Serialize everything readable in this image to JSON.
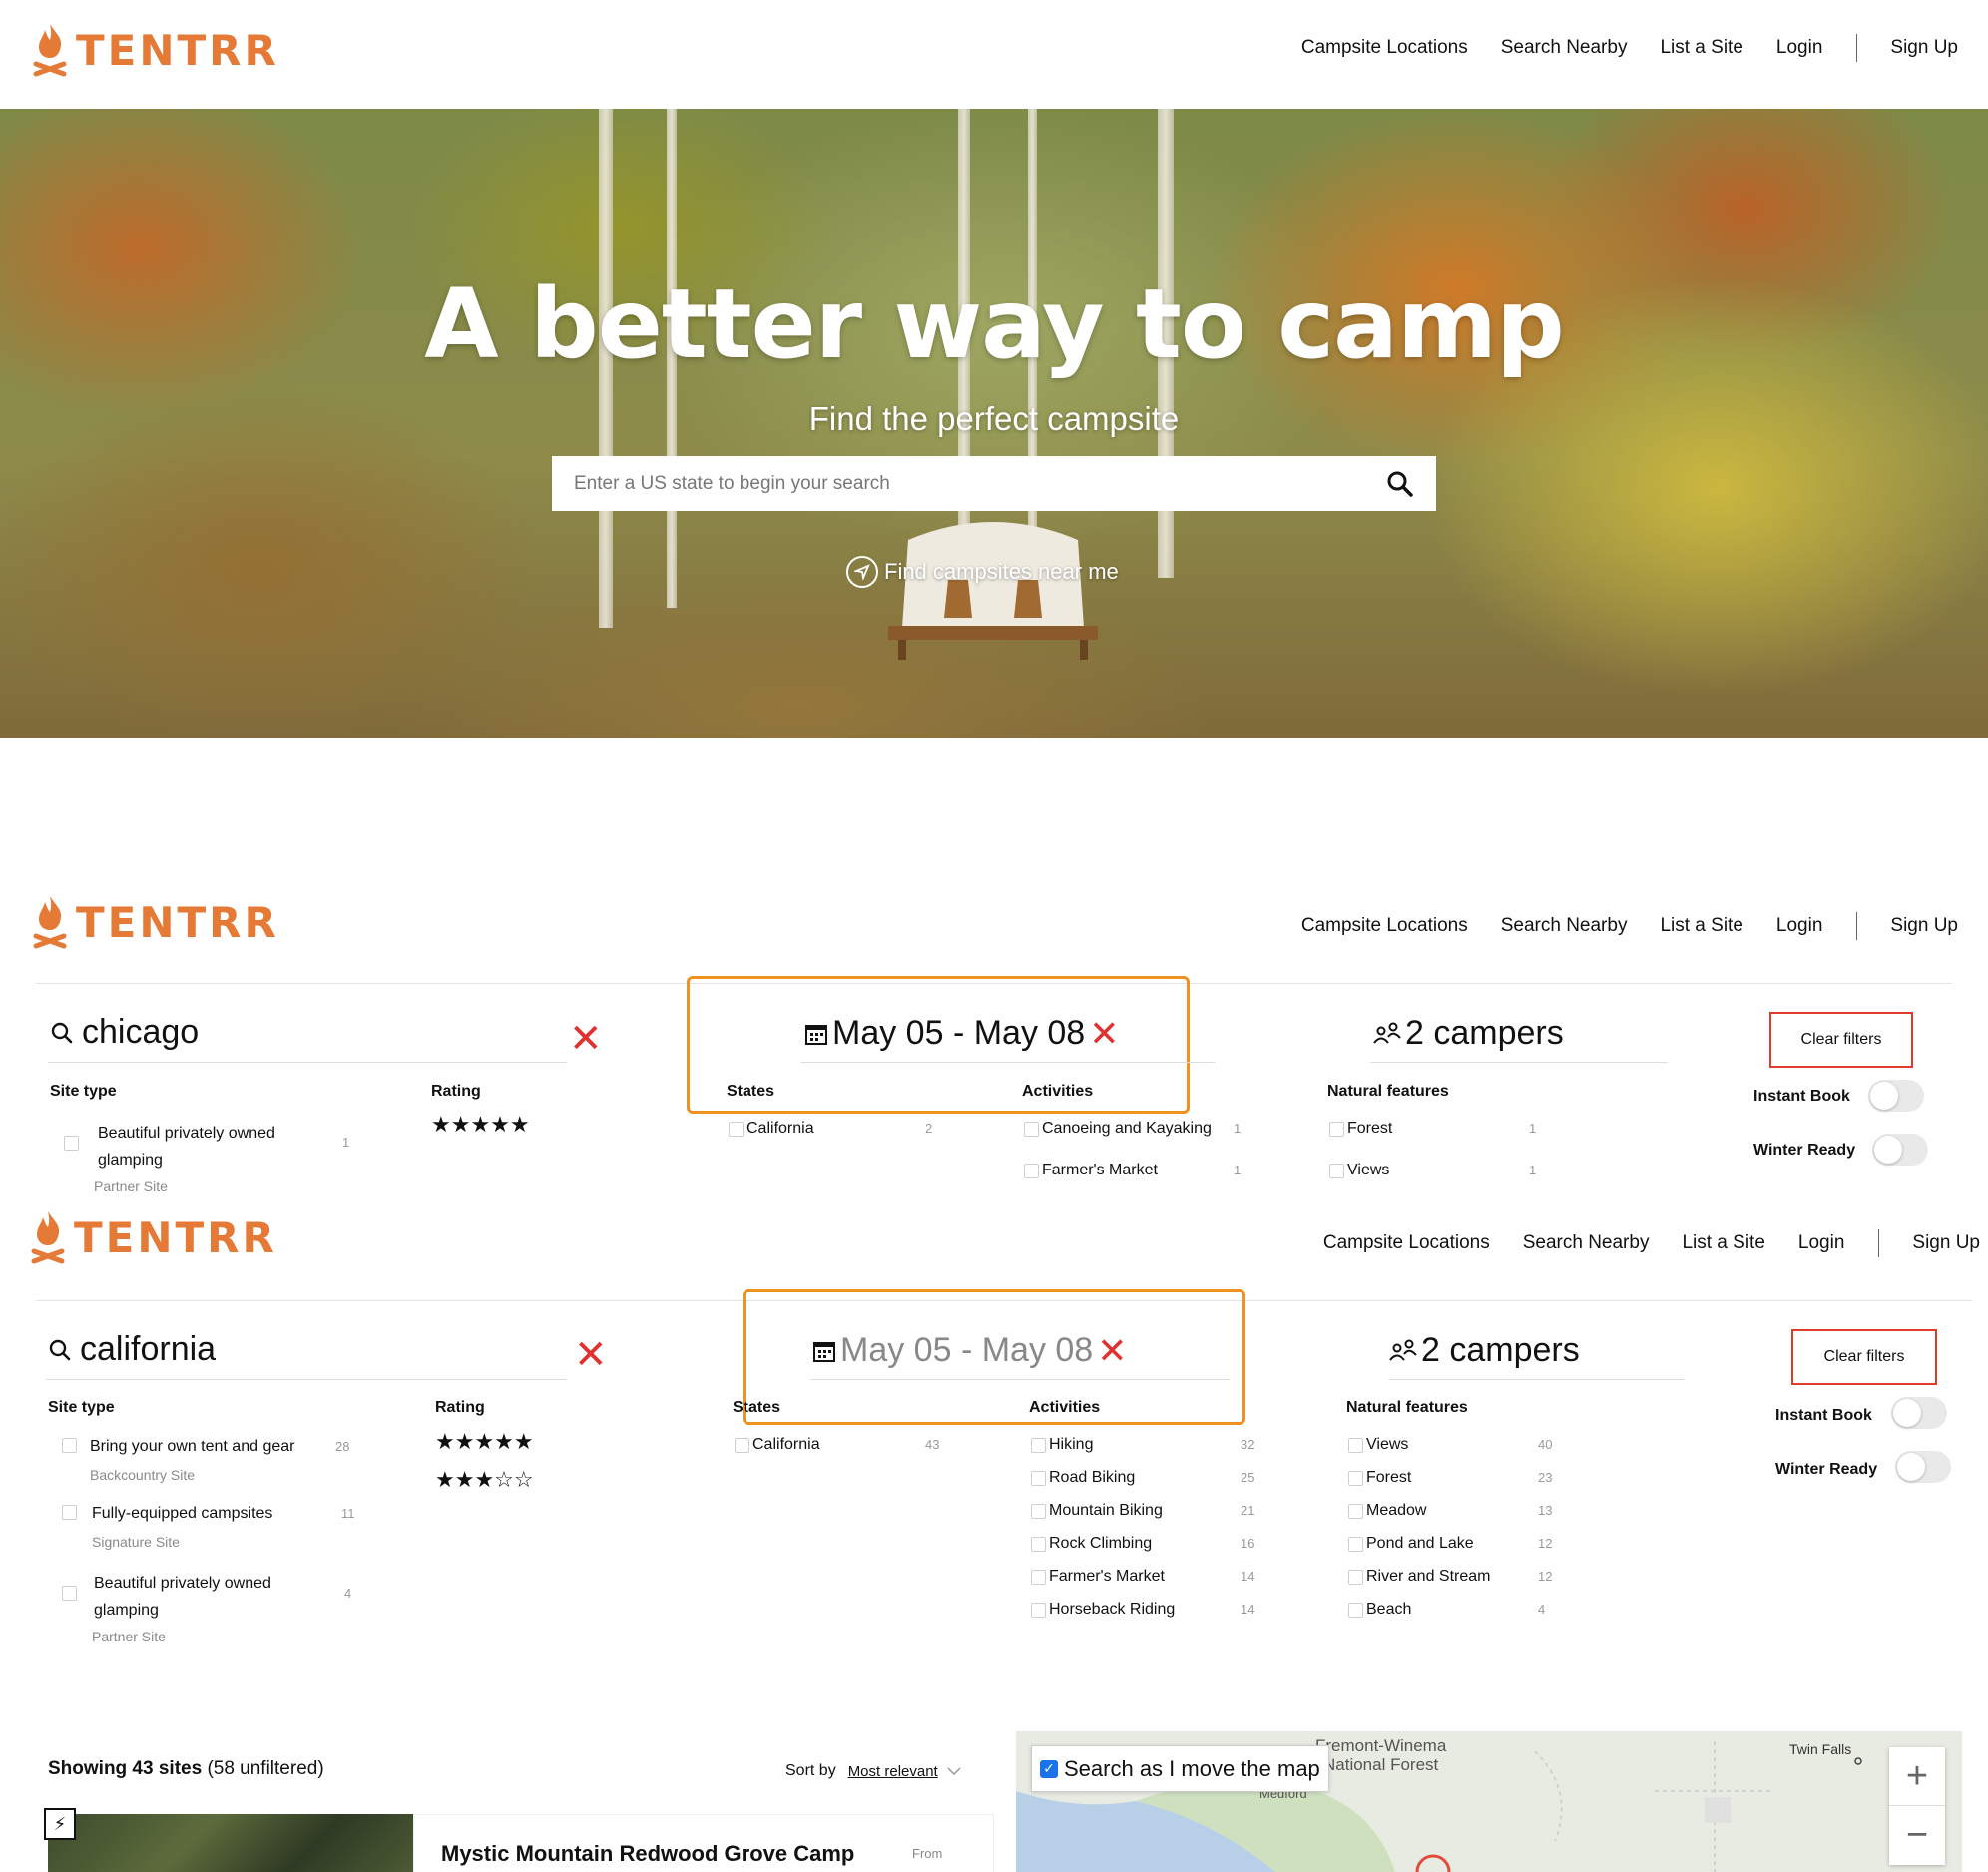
{
  "header": {
    "brand": "TENTRR",
    "nav": [
      "Campsite Locations",
      "Search Nearby",
      "List a Site",
      "Login"
    ],
    "signup": "Sign Up"
  },
  "hero": {
    "title": "A better way to camp",
    "subtitle": "Find the perfect campsite",
    "search_placeholder": "Enter a US state to begin your search",
    "near_me": "Find campsites near me"
  },
  "panel1": {
    "query": "chicago",
    "dates": "May 05 - May 08",
    "campers": "2 campers",
    "clear_filters": "Clear filters",
    "headers": {
      "site_type": "Site type",
      "rating": "Rating",
      "states": "States",
      "activities": "Activities",
      "natural_features": "Natural features"
    },
    "site_types": [
      {
        "label": "Beautiful privately owned glamping",
        "sub": "Partner Site",
        "count": "1"
      }
    ],
    "ratings": [
      "★★★★★"
    ],
    "states": [
      {
        "label": "California",
        "count": "2"
      }
    ],
    "activities": [
      {
        "label": "Canoeing and Kayaking",
        "count": "1"
      },
      {
        "label": "Farmer's Market",
        "count": "1"
      }
    ],
    "features": [
      {
        "label": "Forest",
        "count": "1"
      },
      {
        "label": "Views",
        "count": "1"
      }
    ],
    "instant_book": "Instant Book",
    "winter_ready": "Winter Ready"
  },
  "panel2": {
    "query": "california",
    "dates": "May 05 - May 08",
    "campers": "2 campers",
    "clear_filters": "Clear filters",
    "headers": {
      "site_type": "Site type",
      "rating": "Rating",
      "states": "States",
      "activities": "Activities",
      "natural_features": "Natural features"
    },
    "site_types": [
      {
        "label": "Bring your own tent and gear",
        "sub": "Backcountry Site",
        "count": "28"
      },
      {
        "label": "Fully-equipped campsites",
        "sub": "Signature Site",
        "count": "11"
      },
      {
        "label": "Beautiful privately owned glamping",
        "sub": "Partner Site",
        "count": "4"
      }
    ],
    "ratings": [
      "★★★★★",
      "★★★☆☆"
    ],
    "states": [
      {
        "label": "California",
        "count": "43"
      }
    ],
    "activities": [
      {
        "label": "Hiking",
        "count": "32"
      },
      {
        "label": "Road Biking",
        "count": "25"
      },
      {
        "label": "Mountain Biking",
        "count": "21"
      },
      {
        "label": "Rock Climbing",
        "count": "16"
      },
      {
        "label": "Farmer's Market",
        "count": "14"
      },
      {
        "label": "Horseback Riding",
        "count": "14"
      }
    ],
    "features": [
      {
        "label": "Views",
        "count": "40"
      },
      {
        "label": "Forest",
        "count": "23"
      },
      {
        "label": "Meadow",
        "count": "13"
      },
      {
        "label": "Pond and Lake",
        "count": "12"
      },
      {
        "label": "River and Stream",
        "count": "12"
      },
      {
        "label": "Beach",
        "count": "4"
      }
    ],
    "instant_book": "Instant Book",
    "winter_ready": "Winter Ready"
  },
  "results": {
    "showing_count": "Showing 43 sites",
    "unfiltered": "(58 unfiltered)",
    "sort_label": "Sort by",
    "sort_value": "Most relevant",
    "card_title": "Mystic Mountain Redwood Grove Camp",
    "card_from": "From"
  },
  "map": {
    "search_as_move": "Search as I move the map",
    "labels": [
      "Fremont-Winema",
      "National Forest",
      "Medford",
      "Twin Falls"
    ],
    "zoom_in": "+",
    "zoom_out": "−"
  },
  "colors": {
    "brand": "#e57a36",
    "highlight": "#f0921e",
    "clear": "#e03c2c"
  }
}
